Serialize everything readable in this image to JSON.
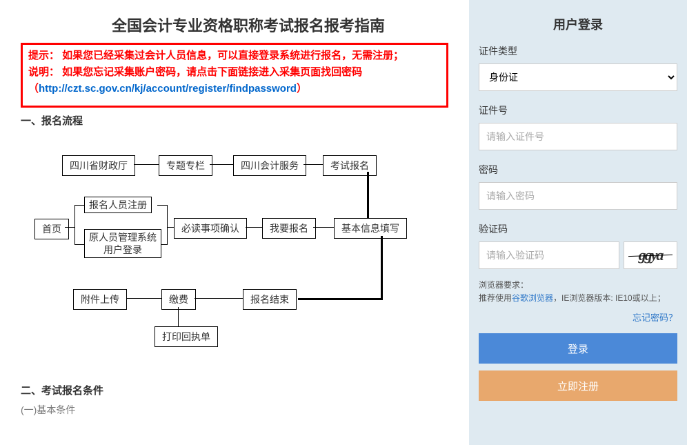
{
  "main": {
    "title": "全国会计专业资格职称考试报名报考指南",
    "hint_prefix": "提示： 如果您已经采集过会计人员信息，可以直接登录系统进行报名，无需注册；",
    "instruction": "说明： 如果您忘记采集账户密码，请点击下面链接进入采集页面找回密码",
    "password_link_prefix": "（",
    "password_link": "http://czt.sc.gov.cn/kj/account/register/findpassword",
    "password_link_suffix": "）",
    "section1": "一、报名流程",
    "section2": "二、考试报名条件",
    "subsection2_1": "(一)基本条件",
    "flow": {
      "n1": "四川省财政厅",
      "n2": "专题专栏",
      "n3": "四川会计服务",
      "n4": "考试报名",
      "n5": "首页",
      "n6": "报名人员注册",
      "n7_l1": "原人员管理系统",
      "n7_l2": "用户登录",
      "n8": "必读事项确认",
      "n9": "我要报名",
      "n10": "基本信息填写",
      "n11": "附件上传",
      "n12": "缴费",
      "n13": "报名结束",
      "n14": "打印回执单"
    }
  },
  "login": {
    "title": "用户登录",
    "id_type_label": "证件类型",
    "id_type_value": "身份证",
    "id_no_label": "证件号",
    "id_no_placeholder": "请输入证件号",
    "pw_label": "密码",
    "pw_placeholder": "请输入密码",
    "captcha_label": "验证码",
    "captcha_placeholder": "请输入验证码",
    "captcha_image": "ggya",
    "browser_req_label": "浏览器要求：",
    "browser_req_text_prefix": "推荐使用",
    "browser_chrome": "谷歌浏览器",
    "browser_req_text_suffix": "，IE浏览器版本: IE10或以上；",
    "forgot": "忘记密码？",
    "login_btn": "登录",
    "register_btn": "立即注册"
  }
}
